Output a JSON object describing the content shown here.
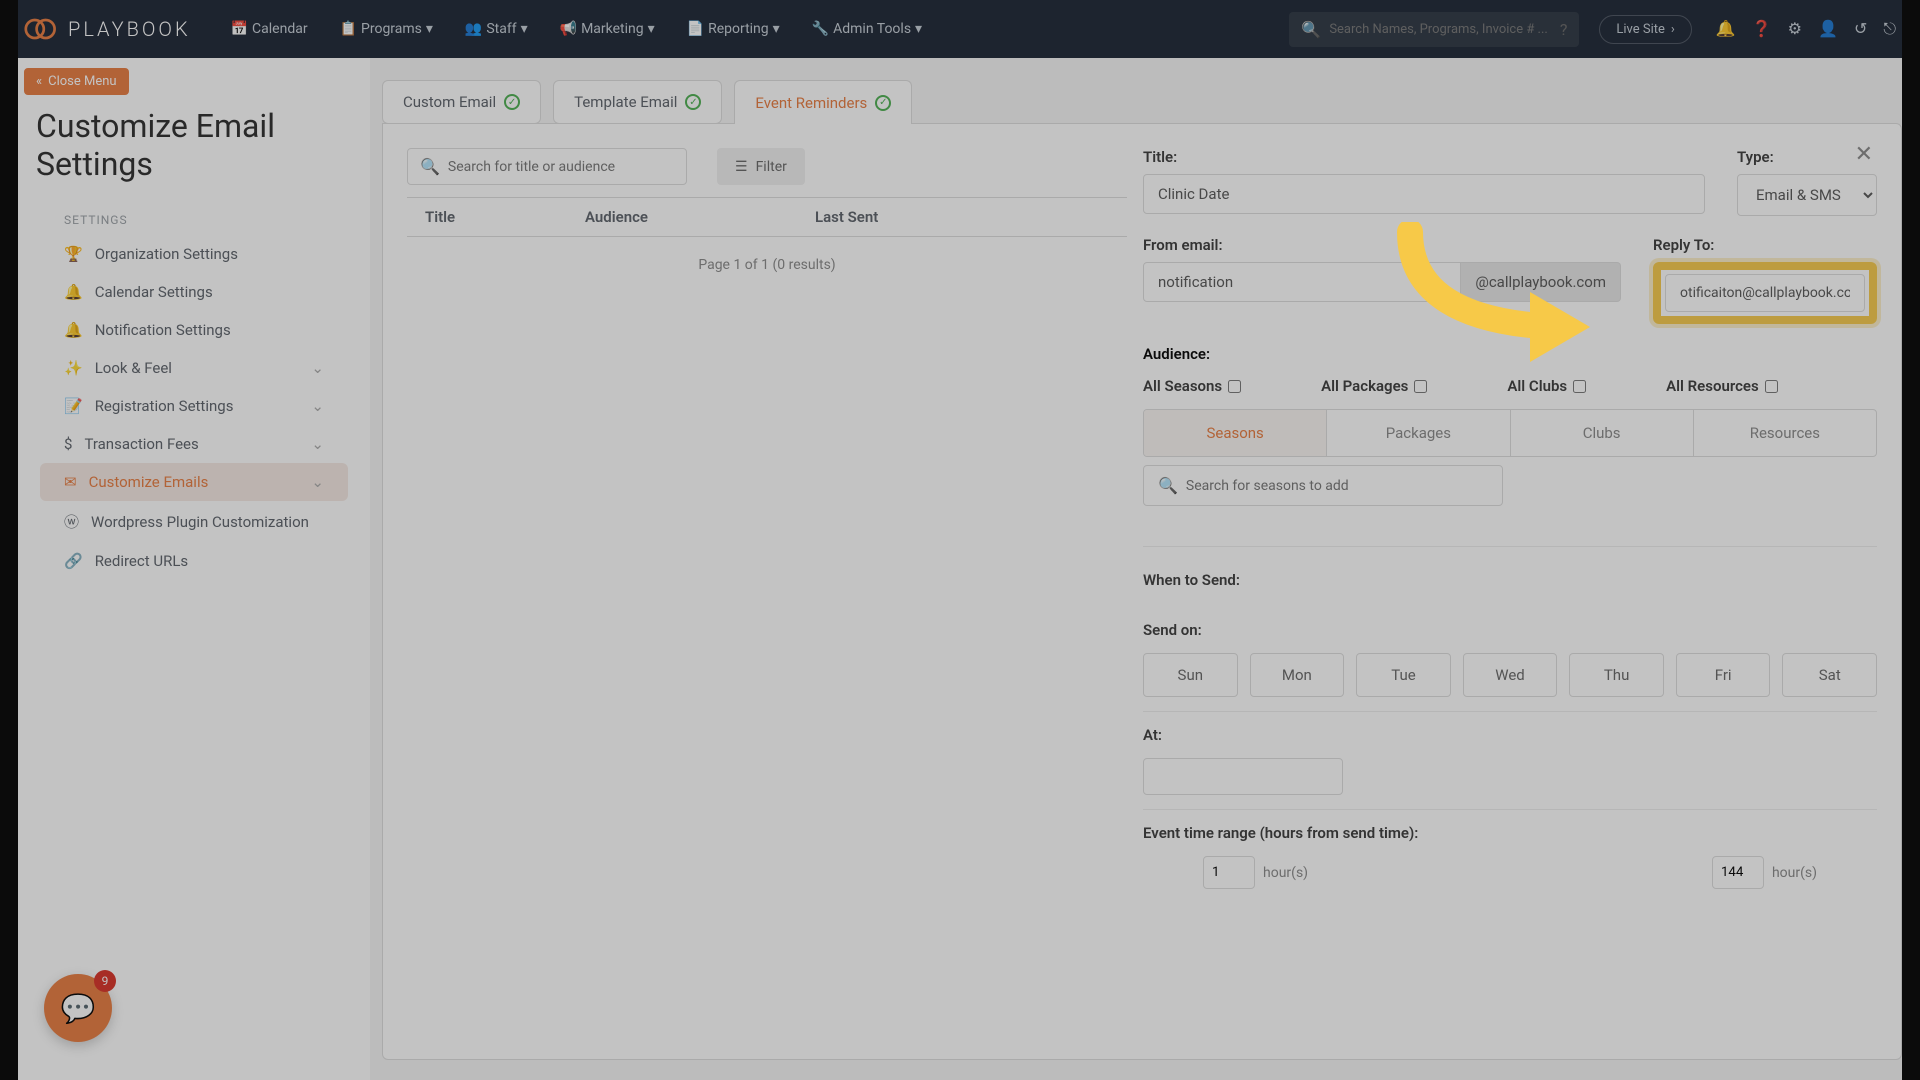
{
  "brand": {
    "name": "PLAYBOOK"
  },
  "nav": {
    "calendar": "Calendar",
    "programs": "Programs",
    "staff": "Staff",
    "marketing": "Marketing",
    "reporting": "Reporting",
    "admin": "Admin Tools"
  },
  "search": {
    "placeholder": "Search Names, Programs, Invoice # ..."
  },
  "live_site": "Live Site",
  "close_menu": "Close Menu",
  "page_title": "Customize Email Settings",
  "settings_label": "SETTINGS",
  "sidebar": [
    {
      "label": "Organization Settings"
    },
    {
      "label": "Calendar Settings"
    },
    {
      "label": "Notification Settings"
    },
    {
      "label": "Look & Feel",
      "expandable": true
    },
    {
      "label": "Registration Settings",
      "expandable": true
    },
    {
      "label": "Transaction Fees",
      "expandable": true
    },
    {
      "label": "Customize Emails",
      "expandable": true,
      "active": true
    },
    {
      "label": "Wordpress Plugin Customization"
    },
    {
      "label": "Redirect URLs"
    }
  ],
  "tabs": [
    {
      "label": "Custom Email"
    },
    {
      "label": "Template Email"
    },
    {
      "label": "Event Reminders",
      "active": true
    }
  ],
  "list": {
    "search_placeholder": "Search for title or audience",
    "filter": "Filter",
    "cols": {
      "title": "Title",
      "audience": "Audience",
      "last_sent": "Last Sent"
    },
    "paging": "Page 1 of 1 (0 results)"
  },
  "form": {
    "title_label": "Title:",
    "title_value": "Clinic Date",
    "type_label": "Type:",
    "type_value": "Email & SMS",
    "from_label": "From email:",
    "from_value": "notification",
    "from_suffix": "@callplaybook.com",
    "reply_label": "Reply To:",
    "reply_value": "otificaiton@callplaybook.com",
    "audience_label": "Audience:",
    "aud_checks": {
      "seasons": "All Seasons",
      "packages": "All Packages",
      "clubs": "All Clubs",
      "resources": "All Resources"
    },
    "aud_tabs": {
      "seasons": "Seasons",
      "packages": "Packages",
      "clubs": "Clubs",
      "resources": "Resources"
    },
    "season_search_placeholder": "Search for seasons to add",
    "when_label": "When to Send:",
    "send_on_label": "Send on:",
    "days": [
      "Sun",
      "Mon",
      "Tue",
      "Wed",
      "Thu",
      "Fri",
      "Sat"
    ],
    "at_label": "At:",
    "range_label": "Event time range (hours from send time):",
    "range_from": "1",
    "range_to": "144",
    "hours": "hour(s)"
  },
  "chat_badge": "9"
}
